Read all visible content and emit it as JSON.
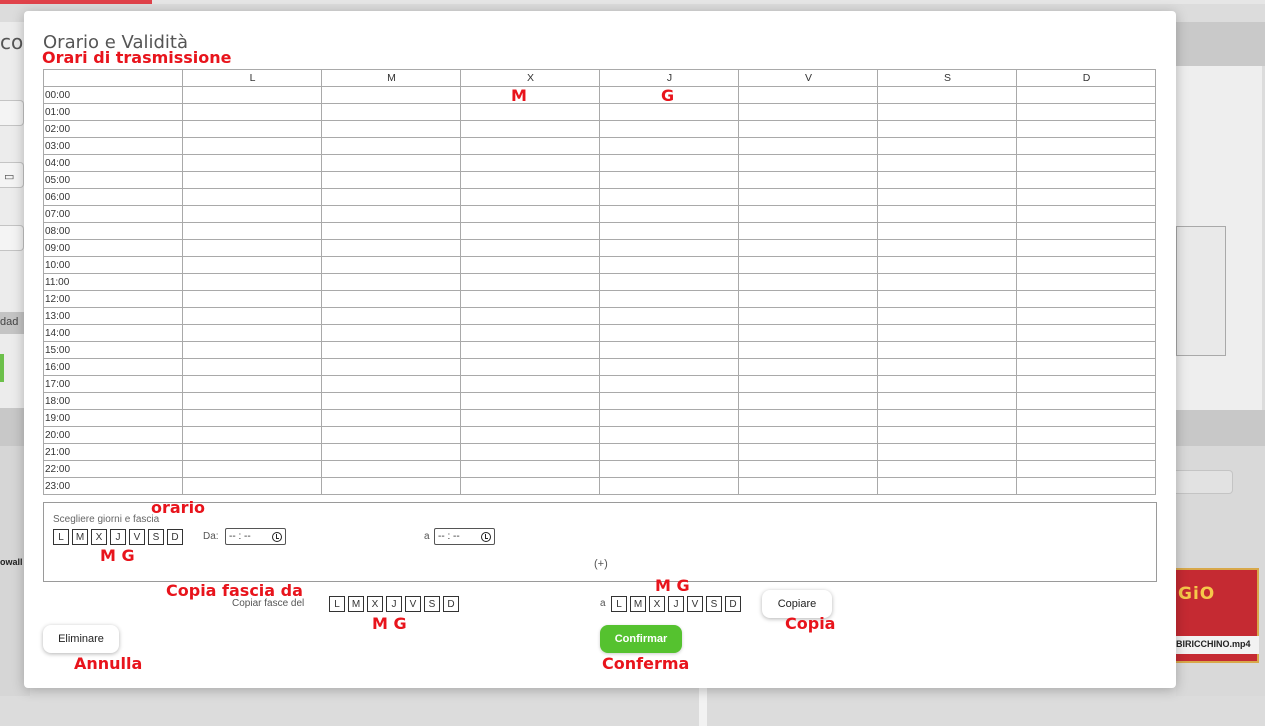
{
  "background": {
    "left_title": "co",
    "left_tag": "dad",
    "left_small": "owall",
    "thumb_logo": "GiO",
    "thumb_label": "BIRICCHINO.mp4"
  },
  "modal": {
    "title": "Orario e Validità",
    "days": [
      "L",
      "M",
      "X",
      "J",
      "V",
      "S",
      "D"
    ],
    "hours": [
      "00:00",
      "01:00",
      "02:00",
      "03:00",
      "04:00",
      "05:00",
      "06:00",
      "07:00",
      "08:00",
      "09:00",
      "10:00",
      "11:00",
      "12:00",
      "13:00",
      "14:00",
      "15:00",
      "16:00",
      "17:00",
      "18:00",
      "19:00",
      "20:00",
      "21:00",
      "22:00",
      "23:00"
    ],
    "range": {
      "label": "Scegliere giorni e fascia",
      "from_label": "Da:",
      "from_value": "-- : --",
      "to_label": "a",
      "to_value": "-- : --",
      "add_label": "(+)"
    },
    "copy": {
      "from_label": "Copiar fasce del",
      "to_label": "a",
      "button_label": "Copiare"
    },
    "delete_button": "Eliminare",
    "confirm_button": "Confirmar"
  },
  "annotations": {
    "schedule_title": "Orari di trasmissione",
    "grid_m": "M",
    "grid_g": "G",
    "orario": "orario",
    "range_mg": "M G",
    "copia_fascia": "Copia fascia da",
    "copy_from_mg": "M  G",
    "copy_to_mg": "M  G",
    "copia": "Copia",
    "annulla": "Annulla",
    "conferma": "Conferma"
  },
  "colors": {
    "annotation": "#e8141c",
    "confirm": "#55c22f",
    "accent": "#e0424a"
  }
}
